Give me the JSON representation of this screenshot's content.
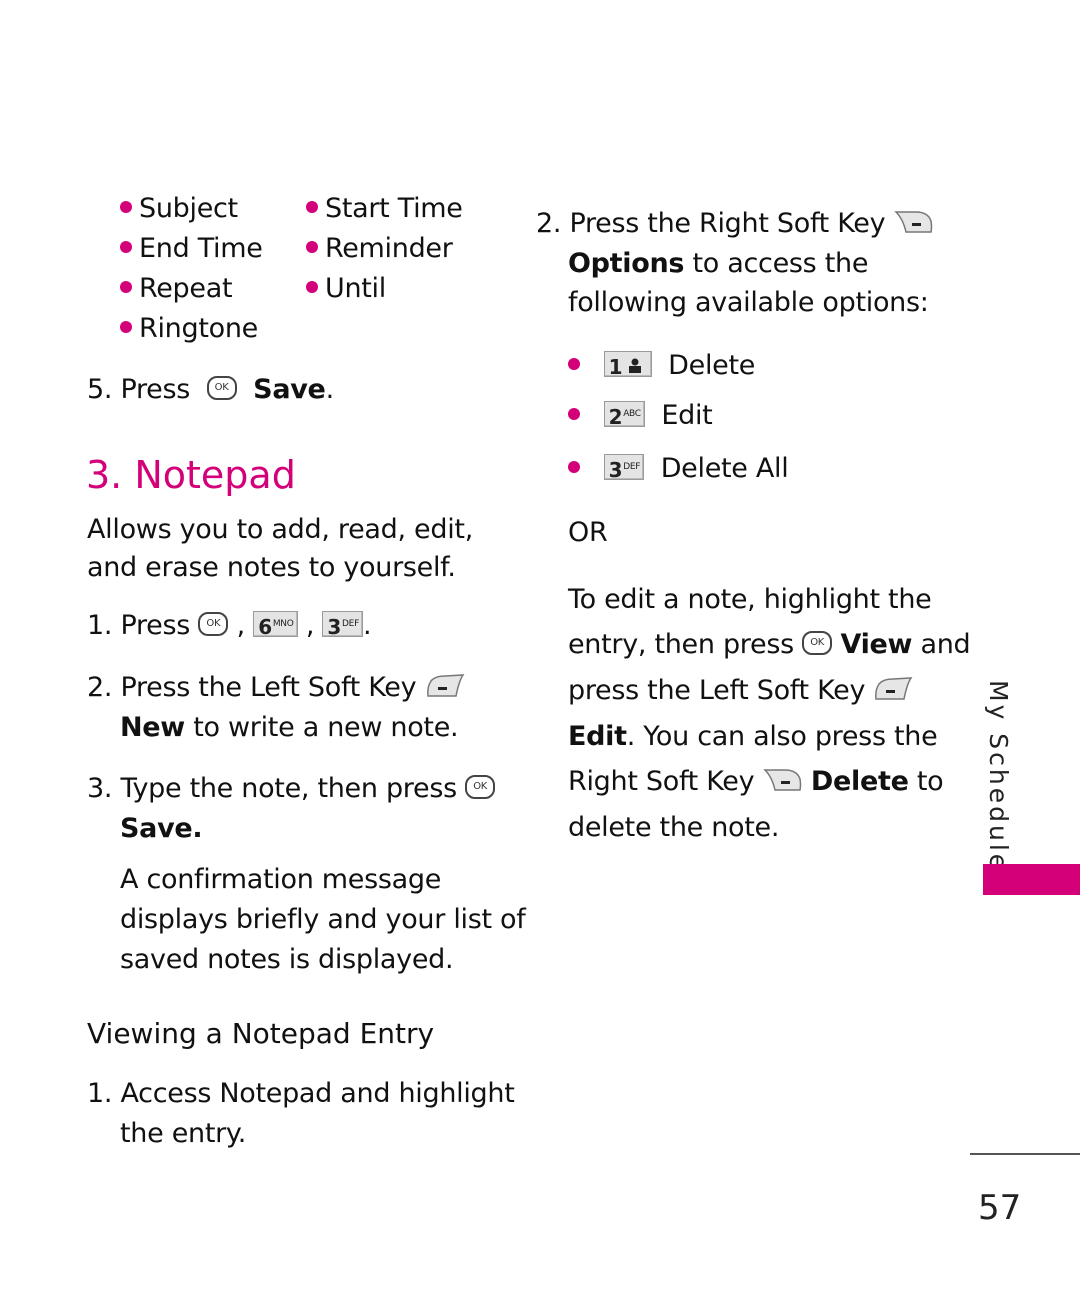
{
  "bullets_top": {
    "col1": [
      "Subject",
      "End Time",
      "Repeat",
      "Ringtone"
    ],
    "col2": [
      "Start Time",
      "Reminder",
      "Until"
    ]
  },
  "step5": {
    "num": "5. Press",
    "ok": "OK",
    "action": "Save",
    "end": "."
  },
  "section": {
    "title": "3. Notepad",
    "intro_line1": "Allows you to add, read, edit,",
    "intro_line2": "and erase notes to yourself."
  },
  "steps": {
    "s1": {
      "num": "1.",
      "text": "Press",
      "ok": "OK",
      "keys": [
        {
          "num": "6",
          "letters": "MNO"
        },
        {
          "num": "3",
          "letters": "DEF"
        }
      ],
      "sep": ",",
      "end": "."
    },
    "s2": {
      "num": "2.",
      "line1": "Press the Left Soft Key",
      "bold": "New",
      "line2_rest": " to write a new note."
    },
    "s3": {
      "num": "3.",
      "line1": "Type the note, then press",
      "ok": "OK",
      "bold": "Save",
      "end": "."
    },
    "confirm": [
      "A confirmation message",
      "displays briefly and your list of",
      "saved notes is displayed."
    ]
  },
  "viewing": {
    "title": "Viewing a Notepad Entry",
    "step1_num": "1.",
    "step1_line1": "Access Notepad and highlight",
    "step1_line2": "the entry."
  },
  "right": {
    "step2_num": "2.",
    "step2_line1": "Press the Right Soft Key",
    "step2_bold": "Options",
    "step2_line2_rest": " to access the",
    "step2_line3": "following available options:",
    "options": [
      {
        "key_num": "1",
        "key_letters": "",
        "label": "Delete"
      },
      {
        "key_num": "2",
        "key_letters": "ABC",
        "label": "Edit"
      },
      {
        "key_num": "3",
        "key_letters": "DEF",
        "label": "Delete All"
      }
    ],
    "or": "OR",
    "para": {
      "l1": "To edit a note, highlight the",
      "l2a": "entry, then press",
      "ok": "OK",
      "l2b": "View",
      "l2c": " and",
      "l3": "press the Left Soft Key",
      "l4a": "Edit",
      "l4b": ". You can also press the",
      "l5a": "Right Soft Key",
      "l5b": "Delete",
      "l5c": " to",
      "l6": "delete the note."
    }
  },
  "sidebar": {
    "label": "My Schedule"
  },
  "page_number": "57",
  "colors": {
    "accent": "#d4007a"
  }
}
